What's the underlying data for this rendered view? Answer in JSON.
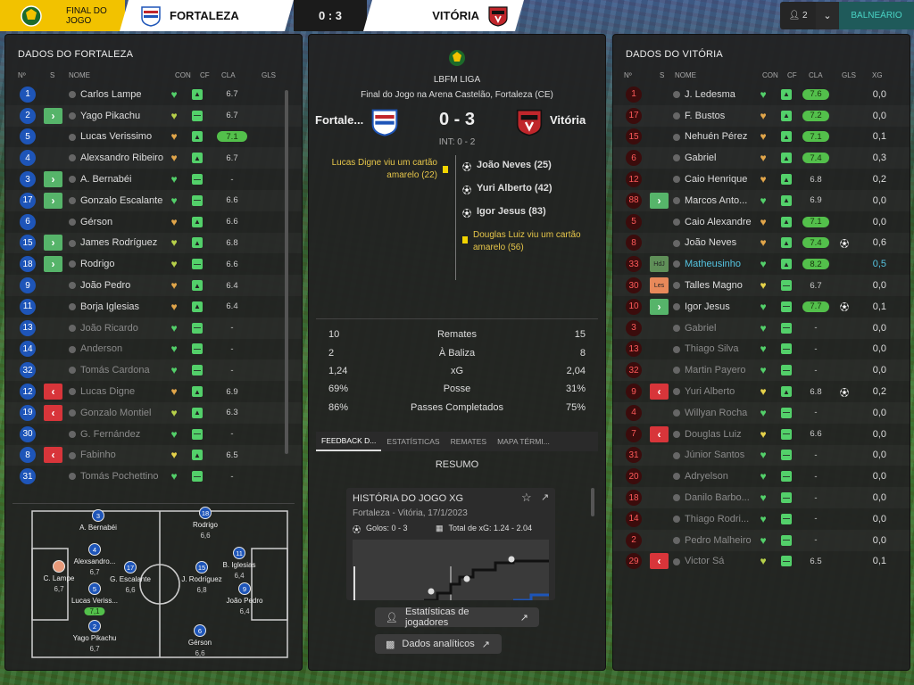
{
  "topbar": {
    "final_label": "FINAL DO JOGO",
    "home_team": "FORTALEZA",
    "score": "0 : 3",
    "away_team": "VITÓRIA",
    "people_count": "2",
    "balneario": "BALNEÁRIO"
  },
  "colors": {
    "home_primary": "#1e55b8",
    "away_primary": "#c0262b",
    "rating_good": "#53c04b",
    "league_yellow": "#f2c200",
    "accent_teal": "#49d3c4"
  },
  "home": {
    "title": "DADOS DO FORTALEZA",
    "headers": {
      "num": "Nº",
      "s": "S",
      "name": "NOME",
      "con": "CON",
      "cf": "CF",
      "cla": "CLA",
      "gls": "GLS"
    },
    "players": [
      {
        "num": "1",
        "sub": "",
        "name": "Carlos Lampe",
        "con": "green",
        "cf": "up",
        "rating": "6.7",
        "good": false,
        "dim": false
      },
      {
        "num": "2",
        "sub": "in",
        "name": "Yago Pikachu",
        "con": "yellowgreen",
        "cf": "flat",
        "rating": "6.7",
        "good": false,
        "dim": false
      },
      {
        "num": "5",
        "sub": "",
        "name": "Lucas Verissimo",
        "con": "orange",
        "cf": "up",
        "rating": "7.1",
        "good": true,
        "dim": false
      },
      {
        "num": "4",
        "sub": "",
        "name": "Alexsandro Ribeiro",
        "con": "orange",
        "cf": "up",
        "rating": "6.7",
        "good": false,
        "dim": false
      },
      {
        "num": "3",
        "sub": "in",
        "name": "A. Bernabéi",
        "con": "green",
        "cf": "flat",
        "rating": "-",
        "good": false,
        "dim": false
      },
      {
        "num": "17",
        "sub": "in",
        "name": "Gonzalo Escalante",
        "con": "green",
        "cf": "flat",
        "rating": "6.6",
        "good": false,
        "dim": false
      },
      {
        "num": "6",
        "sub": "",
        "name": "Gérson",
        "con": "orange",
        "cf": "up",
        "rating": "6.6",
        "good": false,
        "dim": false
      },
      {
        "num": "15",
        "sub": "in",
        "name": "James Rodríguez",
        "con": "yellowgreen",
        "cf": "up",
        "rating": "6.8",
        "good": false,
        "dim": false
      },
      {
        "num": "18",
        "sub": "in",
        "name": "Rodrigo",
        "con": "yellowgreen",
        "cf": "flat",
        "rating": "6.6",
        "good": false,
        "dim": false
      },
      {
        "num": "9",
        "sub": "",
        "name": "João Pedro",
        "con": "orange",
        "cf": "up",
        "rating": "6.4",
        "good": false,
        "dim": false
      },
      {
        "num": "11",
        "sub": "",
        "name": "Borja Iglesias",
        "con": "orange",
        "cf": "up",
        "rating": "6.4",
        "good": false,
        "dim": false
      },
      {
        "num": "13",
        "sub": "",
        "name": "João Ricardo",
        "con": "green",
        "cf": "flat",
        "rating": "-",
        "good": false,
        "dim": true
      },
      {
        "num": "14",
        "sub": "",
        "name": "Anderson",
        "con": "green",
        "cf": "flat",
        "rating": "-",
        "good": false,
        "dim": true
      },
      {
        "num": "32",
        "sub": "",
        "name": "Tomás Cardona",
        "con": "green",
        "cf": "flat",
        "rating": "-",
        "good": false,
        "dim": true
      },
      {
        "num": "12",
        "sub": "out",
        "name": "Lucas Digne",
        "con": "orange",
        "cf": "up",
        "rating": "6.9",
        "good": false,
        "dim": true
      },
      {
        "num": "19",
        "sub": "out",
        "name": "Gonzalo Montiel",
        "con": "yellowgreen",
        "cf": "up",
        "rating": "6.3",
        "good": false,
        "dim": true
      },
      {
        "num": "30",
        "sub": "",
        "name": "G. Fernández",
        "con": "green",
        "cf": "flat",
        "rating": "-",
        "good": false,
        "dim": true
      },
      {
        "num": "8",
        "sub": "out",
        "name": "Fabinho",
        "con": "yellow",
        "cf": "up",
        "rating": "6.5",
        "good": false,
        "dim": true
      },
      {
        "num": "31",
        "sub": "",
        "name": "Tomás Pochettino",
        "con": "green",
        "cf": "flat",
        "rating": "-",
        "good": false,
        "dim": true
      }
    ],
    "pitch": [
      {
        "num": "3",
        "name": "A. Bernabéi",
        "rating": "",
        "good": false
      },
      {
        "num": "18",
        "name": "Rodrigo",
        "rating": "6,6",
        "good": false
      },
      {
        "num": "4",
        "name": "Alexsandro...",
        "rating": "6,7",
        "good": false
      },
      {
        "num": "17",
        "name": "G. Escalante",
        "rating": "6,6",
        "good": false
      },
      {
        "num": "15",
        "name": "J. Rodríguez",
        "rating": "6,8",
        "good": false
      },
      {
        "num": "11",
        "name": "B. Iglesias",
        "rating": "6,4",
        "good": false
      },
      {
        "num": "",
        "name": "C. Lampe",
        "rating": "6,7",
        "good": false
      },
      {
        "num": "5",
        "name": "Lucas Veriss...",
        "rating": "7,1",
        "good": true
      },
      {
        "num": "9",
        "name": "João Pedro",
        "rating": "6,4",
        "good": false
      },
      {
        "num": "2",
        "name": "Yago Pikachu",
        "rating": "6,7",
        "good": false
      },
      {
        "num": "6",
        "name": "Gérson",
        "rating": "6,6",
        "good": false
      }
    ]
  },
  "match": {
    "league": "LBFM LIGA",
    "venue": "Final do Jogo na Arena Castelão, Fortaleza (CE)",
    "home_short": "Fortale...",
    "away_short": "Vitória",
    "score": "0 - 3",
    "halftime": "INT: 0 - 2",
    "events_home": [
      {
        "text": "Lucas Digne viu um cartão amarelo (22)"
      }
    ],
    "events_away": [
      {
        "type": "goal",
        "text": "João Neves (25)"
      },
      {
        "type": "goal",
        "text": "Yuri Alberto (42)"
      },
      {
        "type": "goal",
        "text": "Igor Jesus (83)"
      },
      {
        "type": "card",
        "text": "Douglas Luiz viu um cartão amarelo (56)"
      }
    ],
    "stats": [
      {
        "home": "10",
        "label": "Remates",
        "away": "15"
      },
      {
        "home": "2",
        "label": "À Baliza",
        "away": "8"
      },
      {
        "home": "1,24",
        "label": "xG",
        "away": "2,04"
      },
      {
        "home": "69%",
        "label": "Posse",
        "away": "31%"
      },
      {
        "home": "86%",
        "label": "Passes Completados",
        "away": "75%"
      }
    ],
    "tabs": [
      "FEEDBACK D...",
      "ESTATÍSTICAS",
      "REMATES",
      "MAPA TÉRMI..."
    ],
    "resumo": "RESUMO",
    "xg_card": {
      "title": "HISTÓRIA DO JOGO XG",
      "subtitle": "Fortaleza - Vitória, 17/1/2023",
      "goals": "Golos: 0 - 3",
      "total_xg": "Total de xG: 1.24 - 2.04"
    },
    "buttons": {
      "player_stats": "Estatísticas de jogadores",
      "analytics": "Dados analíticos"
    }
  },
  "away": {
    "title": "DADOS DO VITÓRIA",
    "headers": {
      "num": "Nº",
      "s": "S",
      "name": "NOME",
      "con": "CON",
      "cf": "CF",
      "cla": "CLA",
      "gls": "GLS",
      "xg": "XG"
    },
    "players": [
      {
        "num": "1",
        "tag": "",
        "name": "J. Ledesma",
        "con": "green",
        "cf": "up",
        "rating": "7.6",
        "good": true,
        "goal": false,
        "xg": "0,0",
        "dim": false
      },
      {
        "num": "17",
        "tag": "",
        "name": "F. Bustos",
        "con": "orange",
        "cf": "up",
        "rating": "7.2",
        "good": true,
        "goal": false,
        "xg": "0,0",
        "dim": false
      },
      {
        "num": "15",
        "tag": "",
        "name": "Nehuén Pérez",
        "con": "orange",
        "cf": "up",
        "rating": "7.1",
        "good": true,
        "goal": false,
        "xg": "0,1",
        "dim": false
      },
      {
        "num": "6",
        "tag": "",
        "name": "Gabriel",
        "con": "orange",
        "cf": "up",
        "rating": "7.4",
        "good": true,
        "goal": false,
        "xg": "0,3",
        "dim": false
      },
      {
        "num": "12",
        "tag": "",
        "name": "Caio Henrique",
        "con": "orange",
        "cf": "up",
        "rating": "6.8",
        "good": false,
        "goal": false,
        "xg": "0,2",
        "dim": false
      },
      {
        "num": "88",
        "tag": "in",
        "name": "Marcos Anto...",
        "con": "green",
        "cf": "up",
        "rating": "6.9",
        "good": false,
        "goal": false,
        "xg": "0,0",
        "dim": false
      },
      {
        "num": "5",
        "tag": "",
        "name": "Caio Alexandre",
        "con": "orange",
        "cf": "up",
        "rating": "7.1",
        "good": true,
        "goal": false,
        "xg": "0,0",
        "dim": false
      },
      {
        "num": "8",
        "tag": "",
        "name": "João Neves",
        "con": "orange",
        "cf": "up",
        "rating": "7.4",
        "good": true,
        "goal": true,
        "xg": "0,6",
        "dim": false
      },
      {
        "num": "33",
        "tag": "HdJ",
        "name": "Matheusinho",
        "con": "green",
        "cf": "up",
        "rating": "8.2",
        "good": true,
        "goal": false,
        "xg": "0,5",
        "dim": false,
        "hl": true
      },
      {
        "num": "30",
        "tag": "Les",
        "name": "Talles Magno",
        "con": "yellow",
        "cf": "flat",
        "rating": "6.7",
        "good": false,
        "goal": false,
        "xg": "0,0",
        "dim": false
      },
      {
        "num": "10",
        "tag": "in",
        "name": "Igor Jesus",
        "con": "green",
        "cf": "flat",
        "rating": "7.7",
        "good": true,
        "goal": true,
        "xg": "0,1",
        "dim": false
      },
      {
        "num": "3",
        "tag": "",
        "name": "Gabriel",
        "con": "green",
        "cf": "flat",
        "rating": "-",
        "good": false,
        "goal": false,
        "xg": "0,0",
        "dim": true
      },
      {
        "num": "13",
        "tag": "",
        "name": "Thiago Silva",
        "con": "green",
        "cf": "flat",
        "rating": "-",
        "good": false,
        "goal": false,
        "xg": "0,0",
        "dim": true
      },
      {
        "num": "32",
        "tag": "",
        "name": "Martin Payero",
        "con": "green",
        "cf": "flat",
        "rating": "-",
        "good": false,
        "goal": false,
        "xg": "0,0",
        "dim": true
      },
      {
        "num": "9",
        "tag": "out",
        "name": "Yuri Alberto",
        "con": "yellow",
        "cf": "up",
        "rating": "6.8",
        "good": false,
        "goal": true,
        "xg": "0,2",
        "dim": true
      },
      {
        "num": "4",
        "tag": "",
        "name": "Willyan Rocha",
        "con": "green",
        "cf": "flat",
        "rating": "-",
        "good": false,
        "goal": false,
        "xg": "0,0",
        "dim": true
      },
      {
        "num": "7",
        "tag": "out",
        "name": "Douglas Luiz",
        "con": "yellow",
        "cf": "flat",
        "rating": "6.6",
        "good": false,
        "goal": false,
        "xg": "0,0",
        "dim": true
      },
      {
        "num": "31",
        "tag": "",
        "name": "Júnior Santos",
        "con": "green",
        "cf": "flat",
        "rating": "-",
        "good": false,
        "goal": false,
        "xg": "0,0",
        "dim": true
      },
      {
        "num": "20",
        "tag": "",
        "name": "Adryelson",
        "con": "green",
        "cf": "flat",
        "rating": "-",
        "good": false,
        "goal": false,
        "xg": "0,0",
        "dim": true
      },
      {
        "num": "18",
        "tag": "",
        "name": "Danilo Barbo...",
        "con": "green",
        "cf": "flat",
        "rating": "-",
        "good": false,
        "goal": false,
        "xg": "0,0",
        "dim": true
      },
      {
        "num": "14",
        "tag": "",
        "name": "Thiago Rodri...",
        "con": "green",
        "cf": "flat",
        "rating": "-",
        "good": false,
        "goal": false,
        "xg": "0,0",
        "dim": true
      },
      {
        "num": "2",
        "tag": "",
        "name": "Pedro Malheiro",
        "con": "green",
        "cf": "flat",
        "rating": "-",
        "good": false,
        "goal": false,
        "xg": "0,0",
        "dim": true
      },
      {
        "num": "29",
        "tag": "out",
        "name": "Victor Sá",
        "con": "yellowgreen",
        "cf": "flat",
        "rating": "6.5",
        "good": false,
        "goal": false,
        "xg": "0,1",
        "dim": true
      }
    ]
  }
}
